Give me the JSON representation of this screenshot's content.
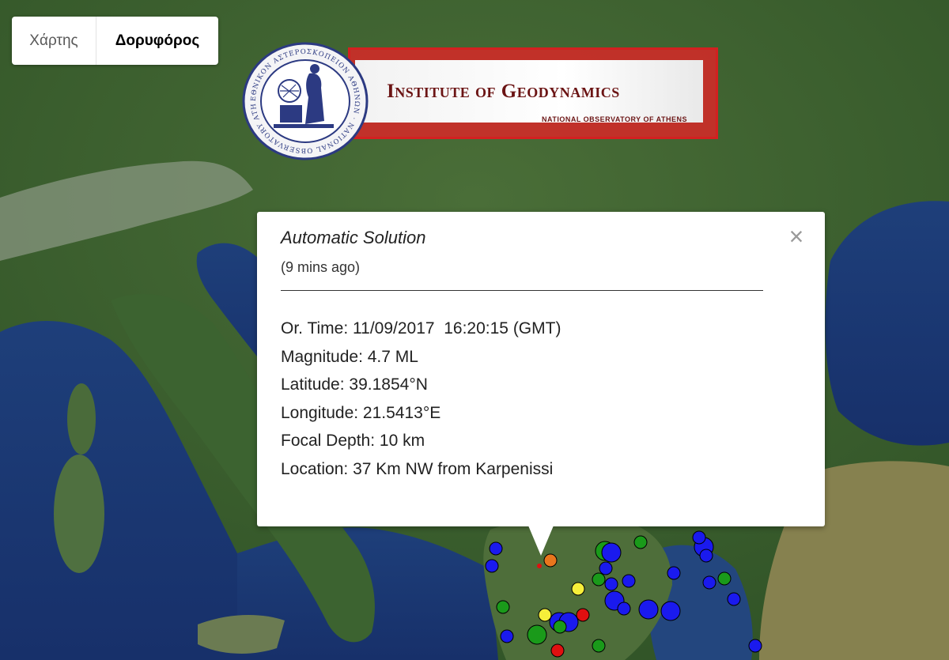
{
  "map_type": {
    "options": [
      {
        "label": "Χάρτης",
        "selected": false
      },
      {
        "label": "Δορυφόρος",
        "selected": true
      }
    ]
  },
  "banner": {
    "title": "Institute of Geodynamics",
    "subtitle": "NATIONAL OBSERVATORY OF ATHENS",
    "seal_text": "ΕΘΝΙΚΟΝ ΑΣΤΕΡΟΣΚΟΠΕΙΟΝ ΑΘΗΝΩΝ · NATIONAL OBSERVATORY ATHENS"
  },
  "info_window": {
    "title": "Automatic Solution",
    "ago": "(9 mins ago)",
    "close_symbol": "×",
    "fields": [
      {
        "label": "Or. Time:",
        "value": " 11/09/2017  16:20:15 (GMT)"
      },
      {
        "label": "Magnitude:",
        "value": " 4.7 ML"
      },
      {
        "label": "Latitude:",
        "value": " 39.1854°N"
      },
      {
        "label": "Longitude:",
        "value": " 21.5413°E"
      },
      {
        "label": "Focal Depth:",
        "value": " 10 km"
      },
      {
        "label": "Location:",
        "value": " 37 Km NW from Karpenissi"
      }
    ]
  },
  "colors": {
    "recent_event": "#e8761d",
    "event_blue": "#1a1aee",
    "event_green": "#1a9a1a",
    "event_yellow": "#f6ef3a",
    "event_red": "#e01010",
    "banner_red": "#d32020"
  },
  "epicenter_markers": [
    {
      "color": "#1a1aee",
      "size": "small"
    },
    {
      "color": "#1a1aee",
      "size": "small"
    },
    {
      "color": "#e8761d",
      "size": "small"
    },
    {
      "color": "#1a9a1a",
      "size": "large"
    },
    {
      "color": "#1a1aee",
      "size": "large"
    },
    {
      "color": "#1a9a1a",
      "size": "small"
    },
    {
      "color": "#1a1aee",
      "size": "small"
    },
    {
      "color": "#1a1aee",
      "size": "small"
    },
    {
      "color": "#f6ef3a",
      "size": "small"
    },
    {
      "color": "#1a1aee",
      "size": "large"
    },
    {
      "color": "#1a9a1a",
      "size": "small"
    },
    {
      "color": "#f6ef3a",
      "size": "small"
    },
    {
      "color": "#1a1aee",
      "size": "large"
    },
    {
      "color": "#1a1aee",
      "size": "large"
    },
    {
      "color": "#e01010",
      "size": "small"
    },
    {
      "color": "#1a9a1a",
      "size": "large"
    },
    {
      "color": "#1a1aee",
      "size": "large"
    },
    {
      "color": "#1a1aee",
      "size": "small"
    },
    {
      "color": "#1a1aee",
      "size": "large"
    },
    {
      "color": "#1a1aee",
      "size": "small"
    },
    {
      "color": "#1a9a1a",
      "size": "small"
    },
    {
      "color": "#1a1aee",
      "size": "small"
    },
    {
      "color": "#1a9a1a",
      "size": "small"
    },
    {
      "color": "#1a1aee",
      "size": "small"
    },
    {
      "color": "#e01010",
      "size": "small"
    },
    {
      "color": "#1a1aee",
      "size": "small"
    },
    {
      "color": "#1a9a1a",
      "size": "small"
    },
    {
      "color": "#1a1aee",
      "size": "large"
    },
    {
      "color": "#1a1aee",
      "size": "small"
    },
    {
      "color": "#1a1aee",
      "size": "small"
    },
    {
      "color": "#1a9a1a",
      "size": "small"
    },
    {
      "color": "#1a1aee",
      "size": "small"
    },
    {
      "color": "#1a1aee",
      "size": "small"
    }
  ]
}
